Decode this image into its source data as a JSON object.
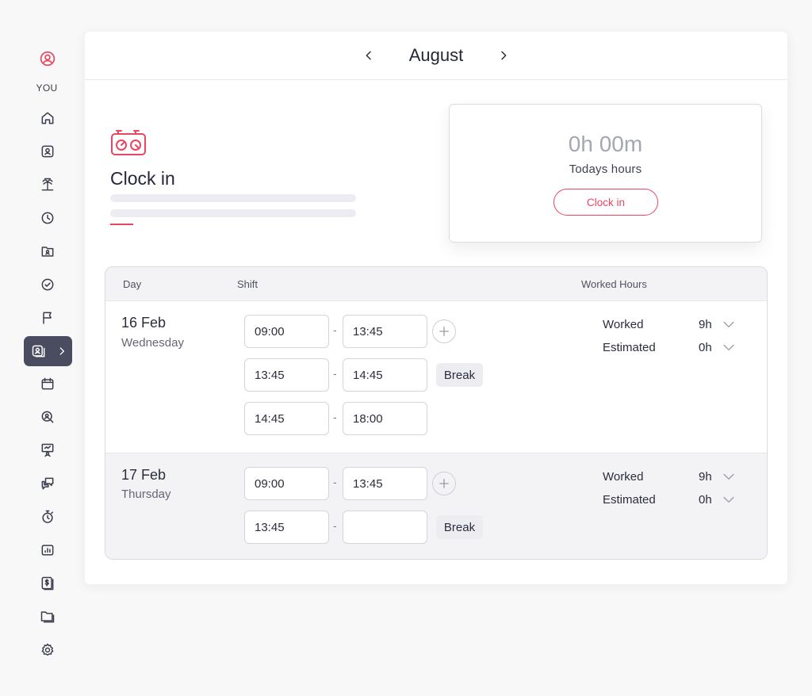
{
  "sidebar": {
    "you_label": "YOU",
    "accent": "#e8475f",
    "active_bg": "#4a4c60"
  },
  "header": {
    "month": "August",
    "prev_icon": "chevron-left-icon",
    "next_icon": "chevron-right-icon"
  },
  "clock": {
    "title": "Clock in",
    "hours_value": "0h 00m",
    "hours_label": "Todays hours",
    "button_label": "Clock in"
  },
  "table": {
    "headers": {
      "day": "Day",
      "shift": "Shift",
      "worked_hours": "Worked Hours"
    },
    "break_label": "Break",
    "dash": "-",
    "days": [
      {
        "date": "16 Feb",
        "weekday": "Wednesday",
        "shifts": [
          {
            "start": "09:00",
            "end": "13:45"
          },
          {
            "start": "13:45",
            "end": "14:45"
          },
          {
            "start": "14:45",
            "end": "18:00"
          }
        ],
        "worked_label": "Worked",
        "worked_value": "9h",
        "estimated_label": "Estimated",
        "estimated_value": "0h"
      },
      {
        "date": "17 Feb",
        "weekday": "Thursday",
        "shifts": [
          {
            "start": "09:00",
            "end": "13:45"
          },
          {
            "start": "13:45",
            "end": ""
          }
        ],
        "worked_label": "Worked",
        "worked_value": "9h",
        "estimated_label": "Estimated",
        "estimated_value": "0h"
      }
    ]
  }
}
